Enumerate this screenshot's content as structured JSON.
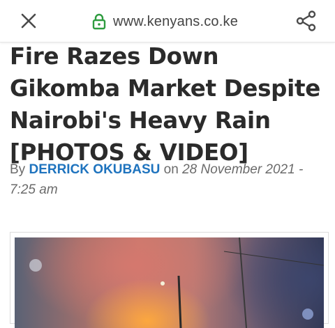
{
  "browser": {
    "url": "www.kenyans.co.ke",
    "close_icon": "close-icon",
    "lock_icon": "lock-icon",
    "share_icon": "share-icon",
    "accent_color": "#2e9c3f"
  },
  "article": {
    "title": "Fire Razes Down Gikomba Market Despite Nairobi's Heavy Rain [PHOTOS & VIDEO]",
    "by_label": "By",
    "author": "DERRICK OKUBASU",
    "on_label": "on",
    "date": "28 November 2021 - 7:25 am",
    "author_color": "#1e73be"
  },
  "media": {
    "image_subject": "market fire at night"
  }
}
